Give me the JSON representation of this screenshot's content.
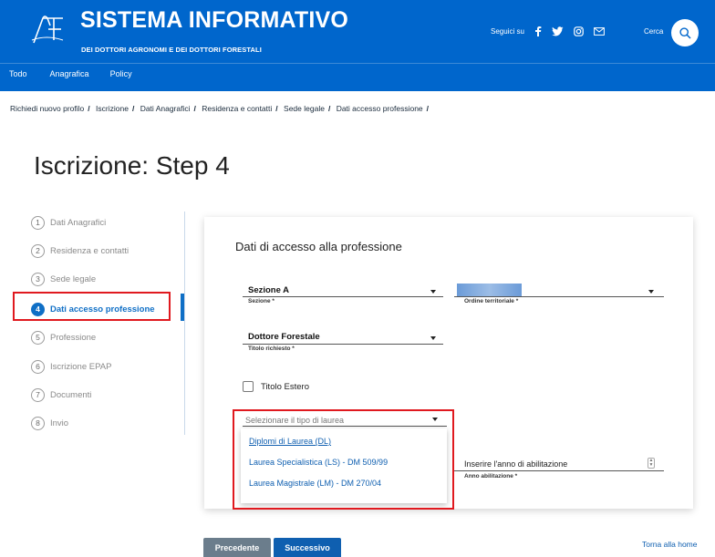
{
  "header": {
    "title": "SISTEMA INFORMATIVO",
    "subtitle": "DEI DOTTORI AGRONOMI E DEI DOTTORI FORESTALI",
    "follow_label": "Seguici su",
    "search_label": "Cerca",
    "nav": [
      "Todo",
      "Anagrafica",
      "Policy"
    ]
  },
  "breadcrumb": [
    "Richiedi nuovo profilo",
    "Iscrizione",
    "Dati Anagrafici",
    "Residenza e contatti",
    "Sede legale",
    "Dati accesso professione"
  ],
  "page_title": "Iscrizione: Step 4",
  "steps": [
    {
      "num": "1",
      "label": "Dati Anagrafici"
    },
    {
      "num": "2",
      "label": "Residenza e contatti"
    },
    {
      "num": "3",
      "label": "Sede legale"
    },
    {
      "num": "4",
      "label": "Dati accesso professione"
    },
    {
      "num": "5",
      "label": "Professione"
    },
    {
      "num": "6",
      "label": "Iscrizione EPAP"
    },
    {
      "num": "7",
      "label": "Documenti"
    },
    {
      "num": "8",
      "label": "Invio"
    }
  ],
  "form": {
    "title": "Dati di accesso alla professione",
    "sezione": {
      "value": "Sezione A",
      "label": "Sezione *"
    },
    "ordine": {
      "value": "",
      "label": "Ordine territoriale *"
    },
    "titolo": {
      "value": "Dottore Forestale",
      "label": "Titolo richiesto *"
    },
    "titolo_estero": "Titolo Estero",
    "laurea": {
      "placeholder": "Selezionare il tipo di laurea",
      "options": [
        "Diplomi di Laurea (DL)",
        "Laurea Specialistica (LS) - DM 509/99",
        "Laurea Magistrale (LM) - DM 270/04"
      ]
    },
    "anno": {
      "placeholder": "Inserire l'anno di abilitazione",
      "label": "Anno abilitazione *"
    }
  },
  "buttons": {
    "prev": "Precedente",
    "next": "Successivo",
    "home": "Torna alla home"
  },
  "colors": {
    "primary": "#0066cc",
    "highlight": "#e0191f",
    "active_step": "#0f6fc6"
  }
}
